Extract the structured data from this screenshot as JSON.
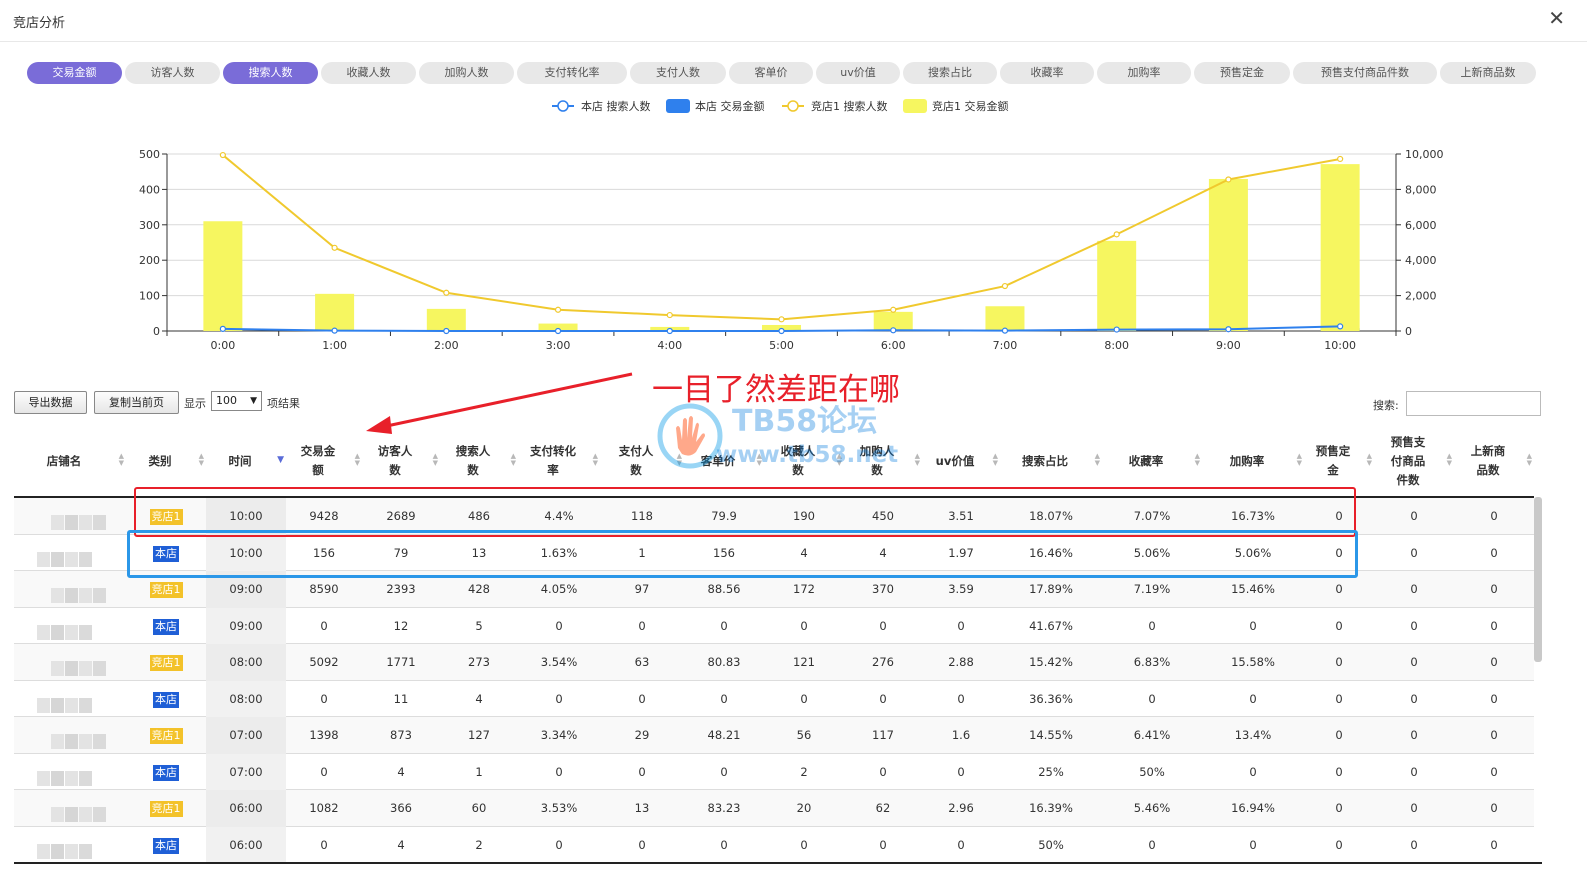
{
  "window": {
    "title": "竞店分析"
  },
  "tabs": [
    "交易金额",
    "访客人数",
    "搜索人数",
    "收藏人数",
    "加购人数",
    "支付转化率",
    "支付人数",
    "客单价",
    "uv价值",
    "搜索占比",
    "收藏率",
    "加购率",
    "预售定金",
    "预售支付商品件数",
    "上新商品数"
  ],
  "active_tabs": [
    "交易金额",
    "搜索人数"
  ],
  "colors": {
    "accent": "#7a6cd8",
    "mine": "#2f80ed",
    "rival": "#f6f660",
    "rival_line": "#f0c92e",
    "annotation": "#e8202a",
    "highlight_blue": "#2b97e8"
  },
  "chart_data": {
    "type": "bar",
    "categories": [
      "0:00",
      "1:00",
      "2:00",
      "3:00",
      "4:00",
      "5:00",
      "6:00",
      "7:00",
      "8:00",
      "9:00",
      "10:00"
    ],
    "series": [
      {
        "name": "本店 搜索人数",
        "kind": "line",
        "axis": "left",
        "values": [
          6,
          1,
          0,
          0,
          0,
          0,
          2,
          1,
          4,
          5,
          13
        ]
      },
      {
        "name": "本店 交易金额",
        "kind": "bar",
        "axis": "right",
        "values": [
          0,
          0,
          0,
          0,
          0,
          0,
          0,
          0,
          0,
          0,
          156
        ]
      },
      {
        "name": "竞店1 搜索人数",
        "kind": "line",
        "axis": "left",
        "values": [
          497,
          235,
          108,
          60,
          45,
          33,
          60,
          127,
          273,
          428,
          486
        ]
      },
      {
        "name": "竞店1 交易金额",
        "kind": "bar",
        "axis": "right",
        "values": [
          6200,
          2100,
          1250,
          420,
          230,
          340,
          1082,
          1398,
          5092,
          8590,
          9428
        ]
      }
    ],
    "y_left": {
      "ticks": [
        "500",
        "400",
        "300",
        "200",
        "100",
        "0"
      ],
      "range": [
        0,
        500
      ]
    },
    "y_right": {
      "ticks": [
        "10,000",
        "8,000",
        "6,000",
        "4,000",
        "2,000",
        "0"
      ],
      "range": [
        0,
        10000
      ]
    },
    "grid": true,
    "legend": "top-center"
  },
  "toolbar": {
    "export_label": "导出数据",
    "copy_label": "复制当前页",
    "show_label": "显示",
    "page_size": "100",
    "results_label": "项结果",
    "search_label": "搜索:"
  },
  "annotation": {
    "text": "一目了然差距在哪"
  },
  "watermark": {
    "title": "TB58论坛",
    "url": "www.tb58.net"
  },
  "table": {
    "columns": [
      "店铺名",
      "类别",
      "时间",
      "交易金\n额",
      "访客人\n数",
      "搜索人\n数",
      "支付转化\n率",
      "支付人\n数",
      "客单价",
      "收藏人\n数",
      "加购人\n数",
      "uv价值",
      "搜索占比",
      "收藏率",
      "加购率",
      "预售定\n金",
      "预售支\n付商品\n件数",
      "上新商\n品数"
    ],
    "rows": [
      [
        "",
        "竞店1",
        "10:00",
        "9428",
        "2689",
        "486",
        "4.4%",
        "118",
        "79.9",
        "190",
        "450",
        "3.51",
        "18.07%",
        "7.07%",
        "16.73%",
        "0",
        "0",
        "0"
      ],
      [
        "",
        "本店",
        "10:00",
        "156",
        "79",
        "13",
        "1.63%",
        "1",
        "156",
        "4",
        "4",
        "1.97",
        "16.46%",
        "5.06%",
        "5.06%",
        "0",
        "0",
        "0"
      ],
      [
        "",
        "竞店1",
        "09:00",
        "8590",
        "2393",
        "428",
        "4.05%",
        "97",
        "88.56",
        "172",
        "370",
        "3.59",
        "17.89%",
        "7.19%",
        "15.46%",
        "0",
        "0",
        "0"
      ],
      [
        "",
        "本店",
        "09:00",
        "0",
        "12",
        "5",
        "0",
        "0",
        "0",
        "0",
        "0",
        "0",
        "41.67%",
        "0",
        "0",
        "0",
        "0",
        "0"
      ],
      [
        "",
        "竞店1",
        "08:00",
        "5092",
        "1771",
        "273",
        "3.54%",
        "63",
        "80.83",
        "121",
        "276",
        "2.88",
        "15.42%",
        "6.83%",
        "15.58%",
        "0",
        "0",
        "0"
      ],
      [
        "",
        "本店",
        "08:00",
        "0",
        "11",
        "4",
        "0",
        "0",
        "0",
        "0",
        "0",
        "0",
        "36.36%",
        "0",
        "0",
        "0",
        "0",
        "0"
      ],
      [
        "",
        "竞店1",
        "07:00",
        "1398",
        "873",
        "127",
        "3.34%",
        "29",
        "48.21",
        "56",
        "117",
        "1.6",
        "14.55%",
        "6.41%",
        "13.4%",
        "0",
        "0",
        "0"
      ],
      [
        "",
        "本店",
        "07:00",
        "0",
        "4",
        "1",
        "0",
        "0",
        "0",
        "2",
        "0",
        "0",
        "25%",
        "50%",
        "0",
        "0",
        "0",
        "0"
      ],
      [
        "",
        "竞店1",
        "06:00",
        "1082",
        "366",
        "60",
        "3.53%",
        "13",
        "83.23",
        "20",
        "62",
        "2.96",
        "16.39%",
        "5.46%",
        "16.94%",
        "0",
        "0",
        "0"
      ],
      [
        "",
        "本店",
        "06:00",
        "0",
        "4",
        "2",
        "0",
        "0",
        "0",
        "0",
        "0",
        "0",
        "50%",
        "0",
        "0",
        "0",
        "0",
        "0"
      ]
    ]
  }
}
